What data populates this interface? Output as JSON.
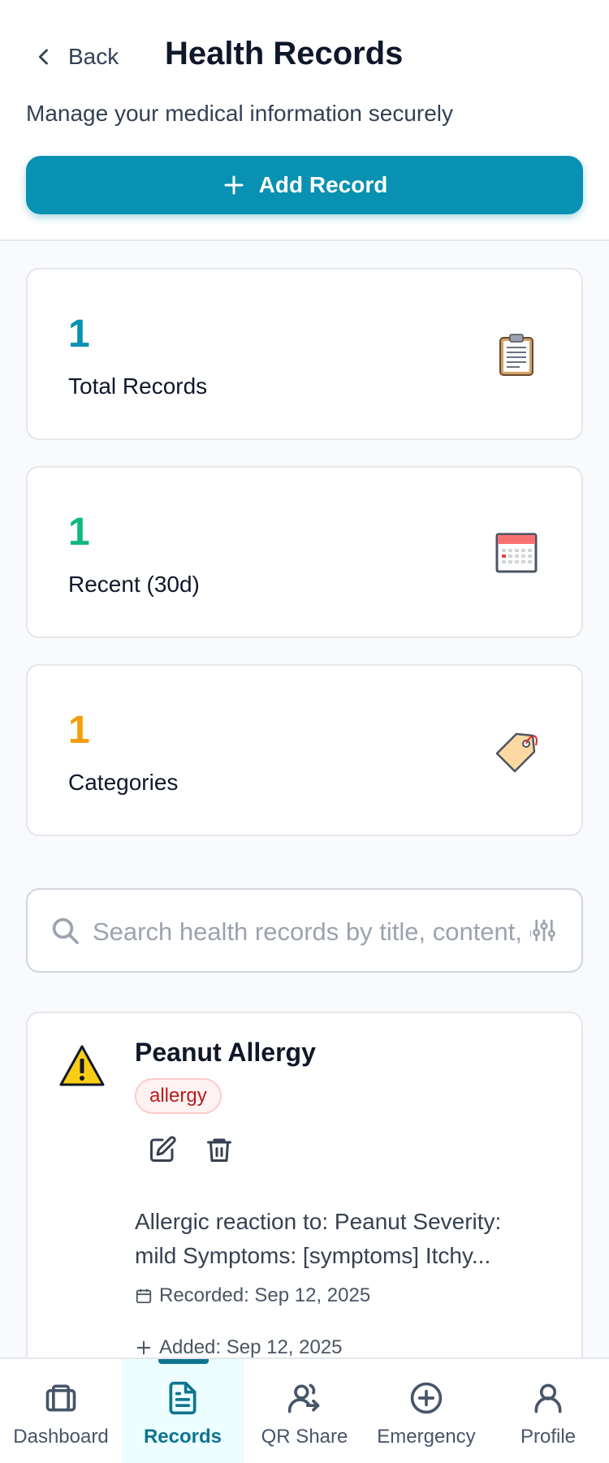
{
  "header": {
    "back_label": "Back",
    "title": "Health Records",
    "subtitle": "Manage your medical information securely",
    "add_button_label": "Add Record"
  },
  "stats": [
    {
      "value": "1",
      "label": "Total Records",
      "color": "#0891b2",
      "icon": "clipboard-icon"
    },
    {
      "value": "1",
      "label": "Recent (30d)",
      "color": "#10b981",
      "icon": "calendar-icon"
    },
    {
      "value": "1",
      "label": "Categories",
      "color": "#f59e0b",
      "icon": "tag-icon"
    }
  ],
  "search": {
    "placeholder": "Search health records by title, content, or category...",
    "value": ""
  },
  "records": [
    {
      "icon": "warning-icon",
      "title": "Peanut Allergy",
      "category": "allergy",
      "description": "Allergic reaction to: Peanut Severity: mild Symptoms: [symptoms] Itchy...",
      "recorded": "Recorded: Sep 12, 2025",
      "added": "Added: Sep 12, 2025"
    }
  ],
  "nav": {
    "items": [
      {
        "label": "Dashboard",
        "icon": "dashboard-icon",
        "active": false
      },
      {
        "label": "Records",
        "icon": "document-icon",
        "active": true
      },
      {
        "label": "QR Share",
        "icon": "share-people-icon",
        "active": false
      },
      {
        "label": "Emergency",
        "icon": "plus-circle-icon",
        "active": false
      },
      {
        "label": "Profile",
        "icon": "user-icon",
        "active": false
      }
    ]
  },
  "colors": {
    "primary": "#0891b2",
    "badge_bg": "#fef2f2",
    "badge_text": "#b91c1c"
  }
}
